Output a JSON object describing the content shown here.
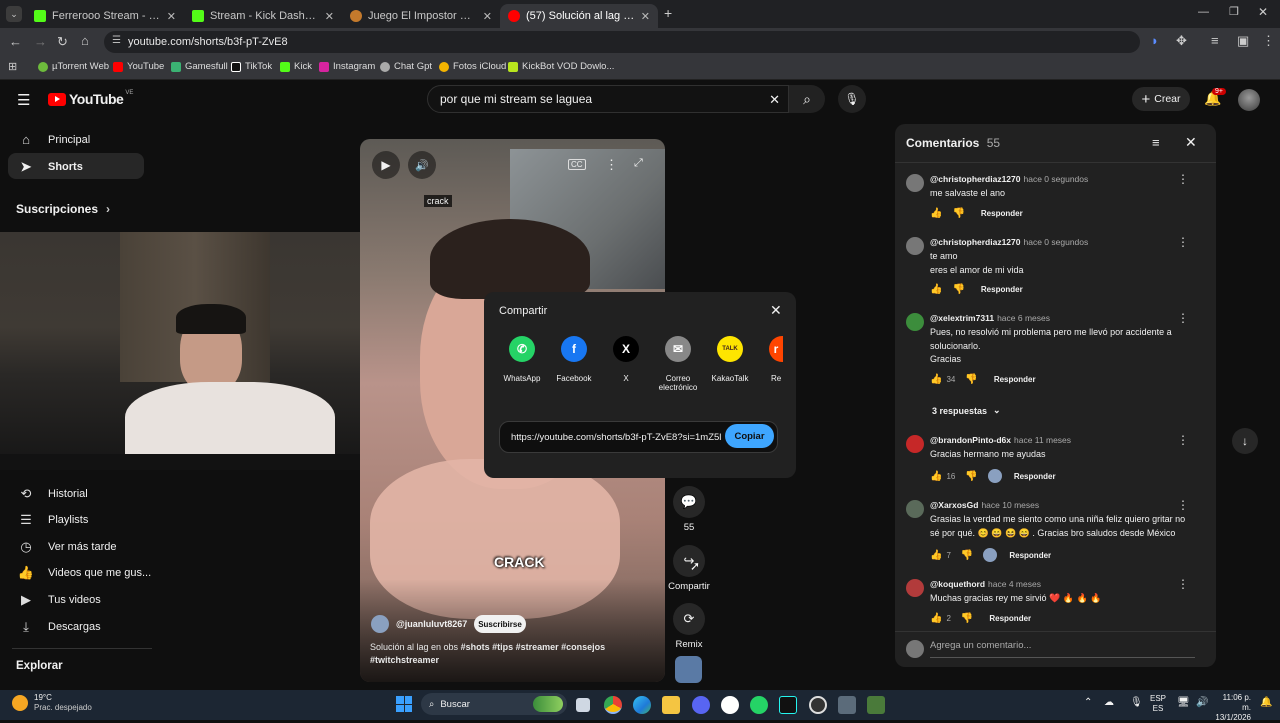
{
  "browser": {
    "tabs": [
      {
        "label": "Ferreroоо Stream - Watch Live",
        "color": "#53fc18"
      },
      {
        "label": "Stream - Kick Dashboard",
        "color": "#53fc18"
      },
      {
        "label": "Juego El Impostor Online - Jug",
        "color": "#c47a2c"
      },
      {
        "label": "(57) Solución al lag en obs #sh",
        "color": "#ff0000"
      }
    ],
    "url": "youtube.com/shorts/b3f-pT-ZvE8",
    "bookmarks": [
      "µTorrent Web",
      "YouTube",
      "Gamesfull",
      "TikTok",
      "Kick",
      "Instagram",
      "Chat Gpt",
      "Fotos iCloud",
      "KickBot VOD Dowlo..."
    ]
  },
  "youtube": {
    "logo": "YouTube",
    "country": "VE",
    "search_value": "por que mi stream se laguea",
    "create_label": "Crear",
    "notif_count": "9+",
    "sidebar_top": [
      {
        "label": "Principal",
        "icon": "home-icon"
      },
      {
        "label": "Shorts",
        "icon": "shorts-icon"
      }
    ],
    "subs_label": "Suscripciones",
    "sidebar_you": [
      {
        "label": "Historial",
        "icon": "history-icon"
      },
      {
        "label": "Playlists",
        "icon": "playlist-icon"
      },
      {
        "label": "Ver más tarde",
        "icon": "clock-icon"
      },
      {
        "label": "Videos que me gus...",
        "icon": "like-icon"
      },
      {
        "label": "Tus videos",
        "icon": "video-icon"
      },
      {
        "label": "Descargas",
        "icon": "download-icon"
      }
    ],
    "explore_label": "Explorar"
  },
  "short": {
    "caption_top": "crack",
    "caption_mid": "CRACK",
    "channel": "@juanluluvt8267",
    "subscribe_label": "Suscribirse",
    "title": "Solución al lag en obs",
    "hashtags": "#shots #tips #streamer #consejos",
    "hashtags2": "#twitchstreamer",
    "comments_count": "55",
    "share_label": "Compartir",
    "remix_label": "Remix"
  },
  "share_dialog": {
    "title": "Compartir",
    "targets": [
      {
        "label": "WhatsApp",
        "color": "#25d366",
        "glyph": "✆"
      },
      {
        "label": "Facebook",
        "color": "#1877f2",
        "glyph": "f"
      },
      {
        "label": "X",
        "color": "#000000",
        "glyph": "X"
      },
      {
        "label": "Correo electrónico",
        "color": "#888888",
        "glyph": "✉"
      },
      {
        "label": "KakaoTalk",
        "color": "#fee500",
        "glyph": "TALK"
      },
      {
        "label": "Re",
        "color": "#ff4500",
        "glyph": "r"
      }
    ],
    "link": "https://youtube.com/shorts/b3f-pT-ZvE8?si=1mZ5l",
    "copy_label": "Copiar"
  },
  "comments": {
    "title": "Comentarios",
    "count": "55",
    "reply_label": "Responder",
    "replies_label": "3 respuestas",
    "add_placeholder": "Agrega un comentario...",
    "items": [
      {
        "author": "@christopherdiaz1270",
        "time": "hace 0 segundos",
        "lines": [
          "me salvaste el ano"
        ],
        "likes": "",
        "color": "#777777"
      },
      {
        "author": "@christopherdiaz1270",
        "time": "hace 0 segundos",
        "lines": [
          "te amo",
          "eres el amor de mi vida"
        ],
        "likes": "",
        "color": "#777777"
      },
      {
        "author": "@xelextrim7311",
        "time": "hace 6 meses",
        "lines": [
          "Pues, no resolvió mi problema pero me llevó por accidente a",
          "solucionarlo.",
          "Gracias"
        ],
        "likes": "34",
        "color": "#3c8d3c"
      },
      {
        "author": "@brandonPinto-d6x",
        "time": "hace 11 meses",
        "lines": [
          "Gracias hermano me ayudas"
        ],
        "likes": "16",
        "color": "#c62828"
      },
      {
        "author": "@XarxosGd",
        "time": "hace 10 meses",
        "lines": [
          "Grasias la verdad me siento como una niña feliz  quiero gritar no",
          "sé por qué. 😊 😄 😆 😄 . Gracias bro saludos desde México"
        ],
        "likes": "7",
        "color": "#5a6a5a"
      },
      {
        "author": "@koquethord",
        "time": "hace 4 meses",
        "lines": [
          "Muchas gracias rey me sirvió ❤️ 🔥 🔥 🔥"
        ],
        "likes": "2",
        "color": "#b23b3b"
      }
    ]
  },
  "taskbar": {
    "weather_temp": "19°C",
    "weather_desc": "Prac. despejado",
    "search_label": "Buscar",
    "lang1": "ESP",
    "lang2": "ES",
    "time": "11:06 p. m.",
    "date": "13/1/2026"
  }
}
